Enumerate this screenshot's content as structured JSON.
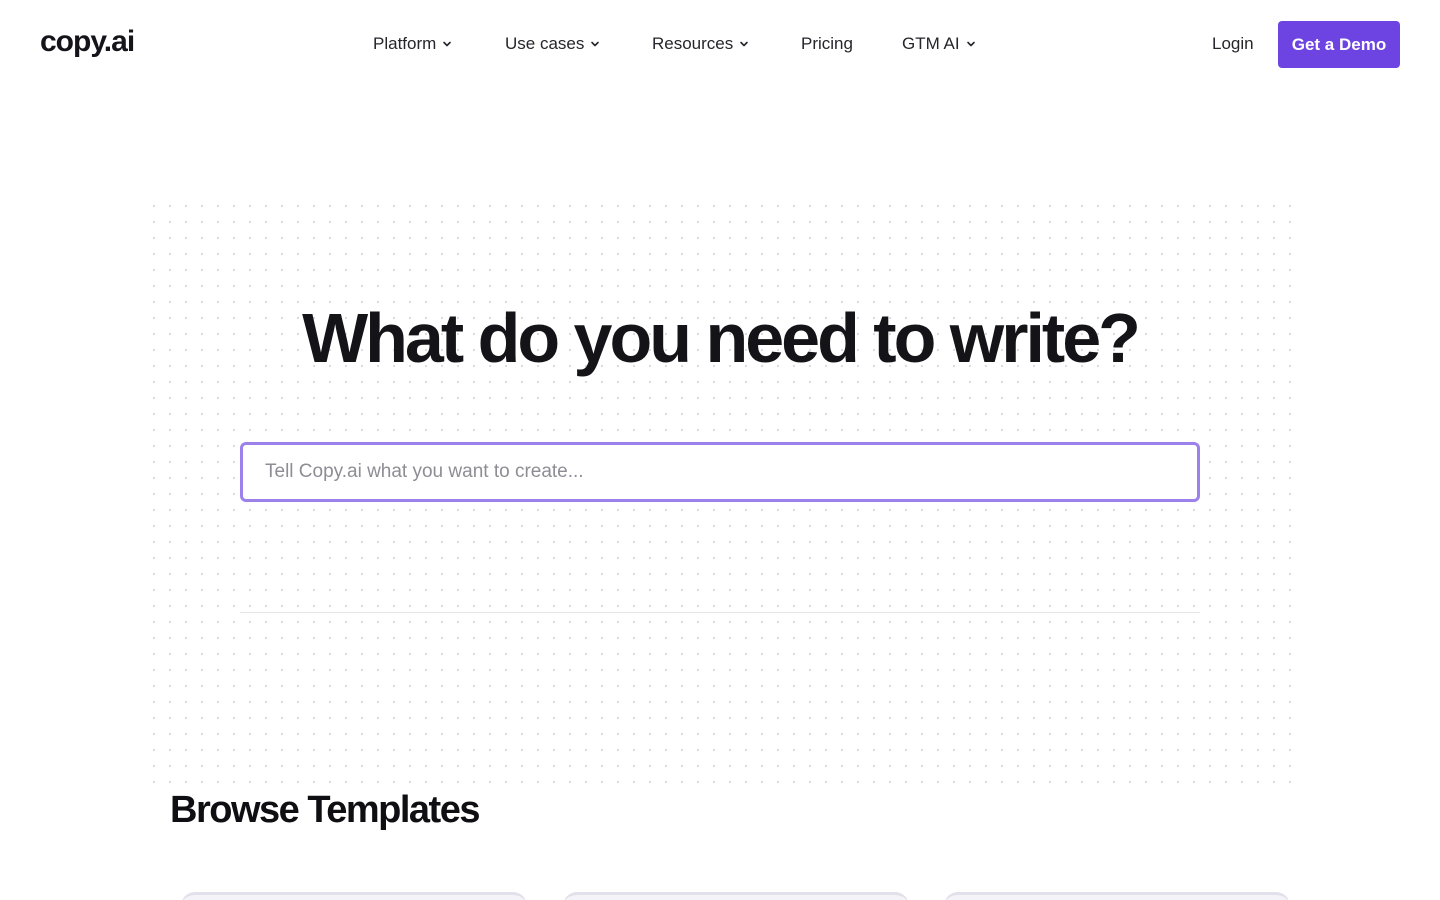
{
  "header": {
    "logo": "copy.ai",
    "nav": [
      {
        "label": "Platform",
        "has_dropdown": true
      },
      {
        "label": "Use cases",
        "has_dropdown": true
      },
      {
        "label": "Resources",
        "has_dropdown": true
      },
      {
        "label": "Pricing",
        "has_dropdown": false
      },
      {
        "label": "GTM AI",
        "has_dropdown": true
      }
    ],
    "login_label": "Login",
    "demo_label": "Get a Demo"
  },
  "hero": {
    "title": "What do you need to write?",
    "input": {
      "value": "",
      "placeholder": "Tell Copy.ai what you want to create..."
    }
  },
  "templates": {
    "title": "Browse Templates",
    "card_count_visible": 3
  },
  "colors": {
    "accent": "#6d44e2",
    "input_border": "#9d81ea",
    "text": "#15141a"
  },
  "icons": {
    "dropdown": "chevron-down-icon"
  }
}
